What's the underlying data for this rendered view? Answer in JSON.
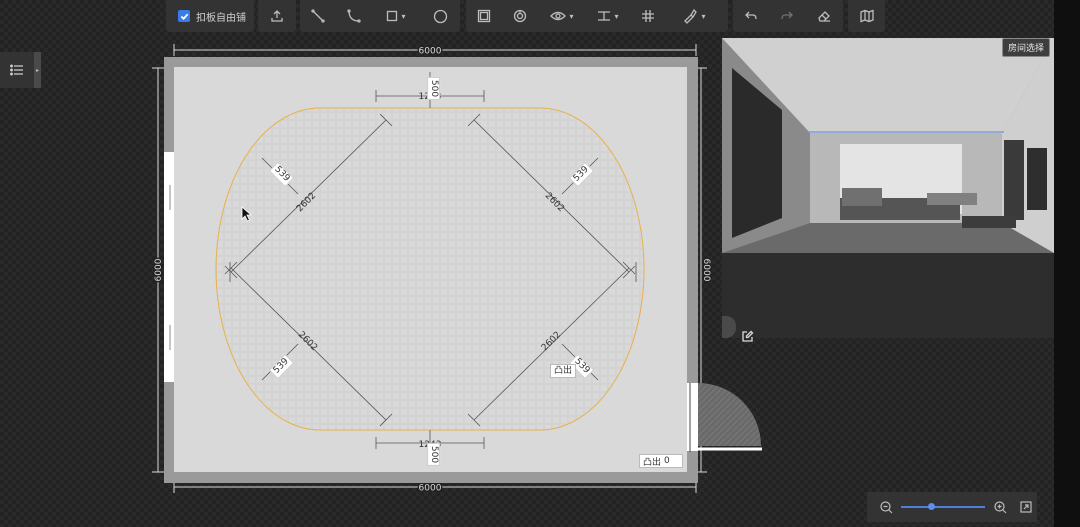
{
  "toolbar": {
    "free_tile_label": "扣板自由铺",
    "free_tile_checked": true,
    "icons": [
      "upload-icon",
      "line-icon",
      "arc-icon",
      "rectangle-icon",
      "circle-icon",
      "frame-icon",
      "spiral-icon",
      "eye-icon",
      "align-icon",
      "grid-icon",
      "paint-icon",
      "undo-icon",
      "redo-icon",
      "eraser-icon",
      "map-icon"
    ]
  },
  "plan": {
    "outer_width_top": "6000",
    "outer_width_bottom": "6000",
    "outer_height_left": "6000",
    "outer_height_right": "6000",
    "top_span": "1243",
    "bottom_span": "1243",
    "top_offset": "500",
    "bottom_offset": "500",
    "diagonal_tl": "2602",
    "diagonal_tr": "2602",
    "diagonal_bl": "2602",
    "diagonal_br": "2602",
    "corner_tl": "539",
    "corner_tr": "539",
    "corner_bl": "539",
    "corner_br": "539",
    "protrude_label": "凸出",
    "protrude_value": "0"
  },
  "preview": {
    "room_select_label": "房间选择"
  },
  "colors": {
    "accent": "#3a7bea",
    "ellipse": "#e8b04a",
    "floor": "#d9d9d9",
    "wall": "#9a9a9a"
  }
}
